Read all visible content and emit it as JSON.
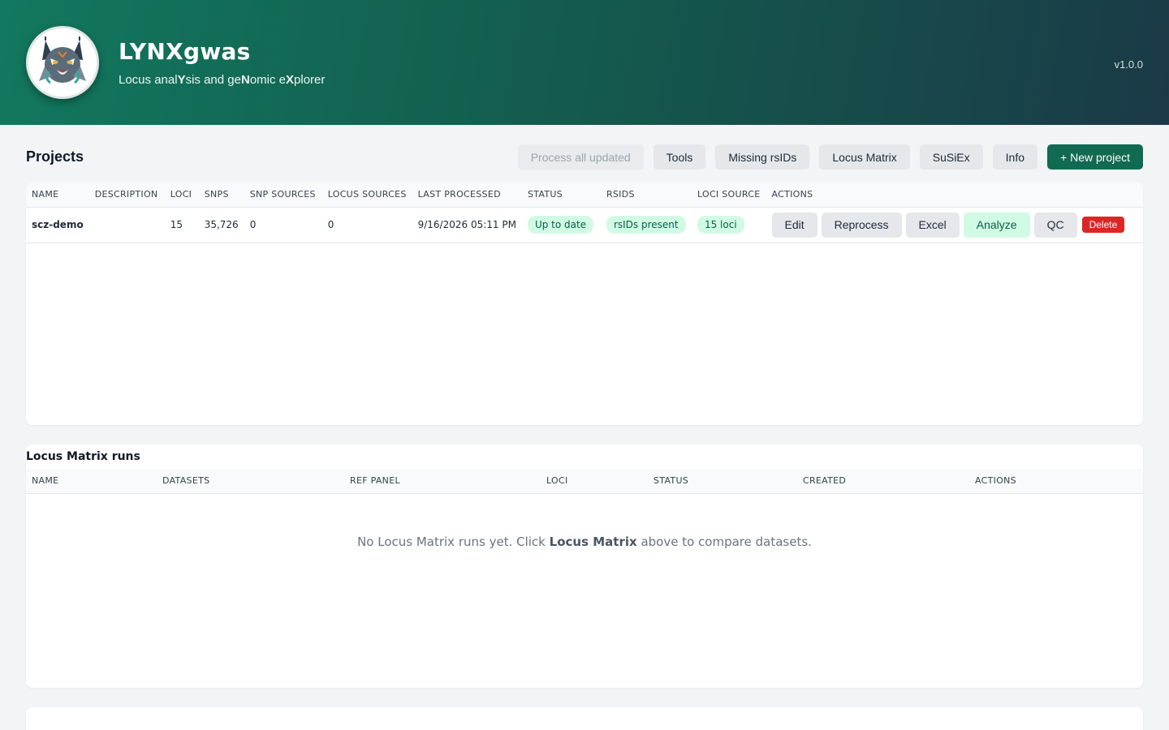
{
  "header": {
    "title": "LYNXgwas",
    "subtitle_parts": [
      "Locus anal",
      "Y",
      "sis and ge",
      "N",
      "omic e",
      "X",
      "plorer"
    ],
    "version": "v1.0.0"
  },
  "projects": {
    "title": "Projects",
    "toolbar": {
      "process_all": "Process all updated",
      "tools": "Tools",
      "missing_rsids": "Missing rsIDs",
      "locus_matrix": "Locus Matrix",
      "susiex": "SuSiEx",
      "info": "Info",
      "new_project": "+ New project"
    },
    "columns": [
      "Name",
      "Description",
      "Loci",
      "SNPs",
      "SNP sources",
      "Locus sources",
      "Last processed",
      "Status",
      "rsIDs",
      "Loci source",
      "Actions"
    ],
    "rows": [
      {
        "name": "scz-demo",
        "description": "",
        "loci": "15",
        "snps": "35,726",
        "snp_sources": "0",
        "locus_sources": "0",
        "last_processed": "9/16/2026 05:11 PM",
        "status": "Up to date",
        "rsids": "rsIDs present",
        "loci_source": "15 loci",
        "actions": {
          "edit": "Edit",
          "reprocess": "Reprocess",
          "excel": "Excel",
          "analyze": "Analyze",
          "qc": "QC",
          "delete": "Delete"
        }
      }
    ]
  },
  "locus_matrix": {
    "title": "Locus Matrix runs",
    "columns": [
      "Name",
      "Datasets",
      "Ref panel",
      "Loci",
      "Status",
      "Created",
      "Actions"
    ],
    "empty_before": "No Locus Matrix runs yet. Click ",
    "empty_bold": "Locus Matrix",
    "empty_after": " above to compare datasets."
  },
  "colors": {
    "brand": "#116a52",
    "header_gradient_start": "#12785e",
    "header_gradient_end": "#1a3a47",
    "success_bg": "#d1fae5",
    "success_text": "#065f46",
    "danger": "#dc2626"
  }
}
